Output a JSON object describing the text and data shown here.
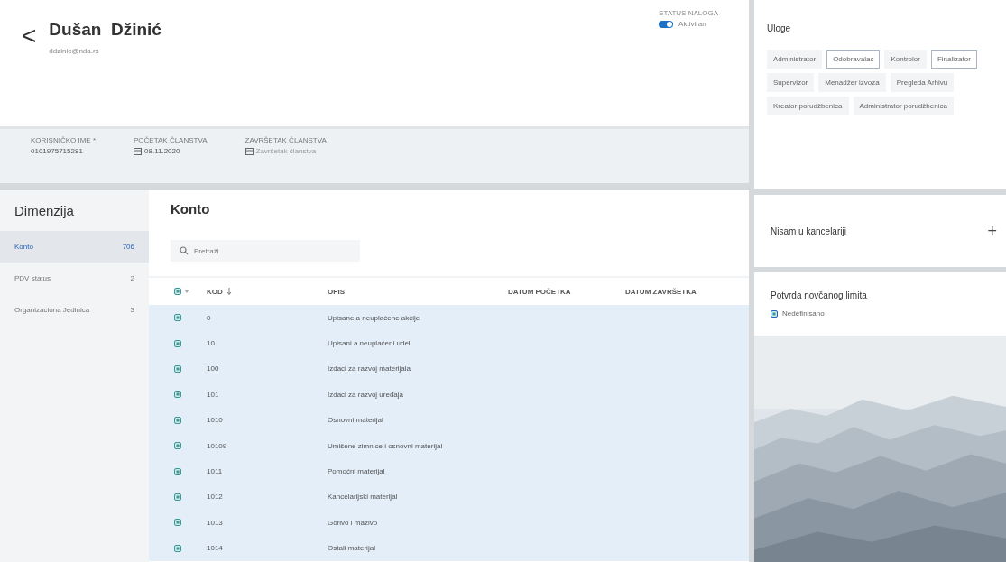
{
  "header": {
    "back": "<",
    "name": "Dušan  Džinić",
    "email": "ddzinic@nda.rs",
    "status_label": "STATUS NALOGA",
    "status_on": true,
    "status_text": "Aktiviran"
  },
  "fields": [
    {
      "kind": "text",
      "label": "KORISNIČKO IME *",
      "value": "0101975715281"
    },
    {
      "kind": "date",
      "label": "POČETAK ČLANSTVA",
      "value": "08.11.2020"
    },
    {
      "kind": "date",
      "label": "ZAVRŠETAK ČLANSTVA",
      "placeholder": "Završetak članstva"
    }
  ],
  "sidebar": {
    "title": "Dimenzija",
    "items": [
      {
        "label": "Konto",
        "count": "706",
        "selected": true
      },
      {
        "label": "PDV status",
        "count": "2",
        "selected": false
      },
      {
        "label": "Organizaciona Jedinica",
        "count": "3",
        "selected": false
      }
    ]
  },
  "content": {
    "title": "Konto",
    "search": {
      "placeholder": "Pretraži"
    },
    "table": {
      "all_checked": true,
      "columns": [
        "KOD",
        "OPIS",
        "DATUM POČETKA",
        "DATUM ZAVRŠETKA"
      ],
      "rows": [
        {
          "kod": "0",
          "opis": "Upisane a neuplaćene akcije",
          "checked": true
        },
        {
          "kod": "10",
          "opis": "Upisani a neuplaćeni udeli",
          "checked": true
        },
        {
          "kod": "100",
          "opis": "Izdaci za razvoj materijala",
          "checked": true
        },
        {
          "kod": "101",
          "opis": "Izdaci za razvoj uređaja",
          "checked": true
        },
        {
          "kod": "1010",
          "opis": "Osnovni materijal",
          "checked": true
        },
        {
          "kod": "10109",
          "opis": "Umišene zimnice i osnovni materijal",
          "checked": true
        },
        {
          "kod": "1011",
          "opis": "Pomoćni materijal",
          "checked": true
        },
        {
          "kod": "1012",
          "opis": "Kancelarijski materijal",
          "checked": true
        },
        {
          "kod": "1013",
          "opis": "Gorivo i mazivo",
          "checked": true
        },
        {
          "kod": "1014",
          "opis": "Ostali materijal",
          "checked": true
        }
      ]
    }
  },
  "roles": {
    "title": "Uloge",
    "items": [
      {
        "label": "Administrator",
        "selected": false
      },
      {
        "label": "Odobravalac",
        "selected": true
      },
      {
        "label": "Kontrolor",
        "selected": false
      },
      {
        "label": "Finalizator",
        "selected": true
      },
      {
        "label": "Supervizor",
        "selected": false
      },
      {
        "label": "Menadžer izvoza",
        "selected": false
      },
      {
        "label": "Pregleda Arhivu",
        "selected": false
      },
      {
        "label": "Kreator porudžbenica",
        "selected": false
      },
      {
        "label": "Administrator porudžbenica",
        "selected": false
      }
    ]
  },
  "office": {
    "title": "Nisam u kancelariji",
    "action": "+"
  },
  "limit": {
    "title": "Potvrda novčanog limita",
    "option": {
      "label": "Nedefinisano",
      "checked": true
    }
  }
}
